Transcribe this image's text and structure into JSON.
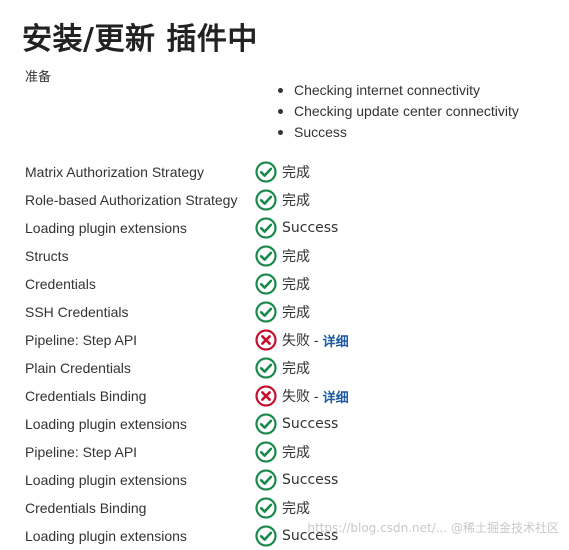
{
  "title": "安装/更新 插件中",
  "preparation": {
    "label": "准备",
    "checks": [
      "Checking internet connectivity",
      "Checking update center connectivity",
      "Success"
    ]
  },
  "plugins": [
    {
      "name": "Matrix Authorization Strategy",
      "status": "success",
      "status_text": "完成"
    },
    {
      "name": "Role-based Authorization Strategy",
      "status": "success",
      "status_text": "完成"
    },
    {
      "name": "Loading plugin extensions",
      "status": "success",
      "status_text": "Success"
    },
    {
      "name": "Structs",
      "status": "success",
      "status_text": "完成"
    },
    {
      "name": "Credentials",
      "status": "success",
      "status_text": "完成"
    },
    {
      "name": "SSH Credentials",
      "status": "success",
      "status_text": "完成"
    },
    {
      "name": "Pipeline: Step API",
      "status": "failure",
      "status_text": "失败",
      "separator": "-",
      "detail_label": "详细"
    },
    {
      "name": "Plain Credentials",
      "status": "success",
      "status_text": "完成"
    },
    {
      "name": "Credentials Binding",
      "status": "failure",
      "status_text": "失败",
      "separator": "-",
      "detail_label": "详细"
    },
    {
      "name": "Loading plugin extensions",
      "status": "success",
      "status_text": "Success"
    },
    {
      "name": "Pipeline: Step API",
      "status": "success",
      "status_text": "完成"
    },
    {
      "name": "Loading plugin extensions",
      "status": "success",
      "status_text": "Success"
    },
    {
      "name": "Credentials Binding",
      "status": "success",
      "status_text": "完成"
    },
    {
      "name": "Loading plugin extensions",
      "status": "success",
      "status_text": "Success"
    }
  ],
  "watermark": "https://blog.csdn.net/... @稀土掘金技术社区",
  "colors": {
    "success": "#1a8a4a",
    "failure": "#c8102e",
    "link": "#1e5aa0"
  },
  "icons": {
    "success": "check-circle-icon",
    "failure": "x-circle-icon"
  }
}
